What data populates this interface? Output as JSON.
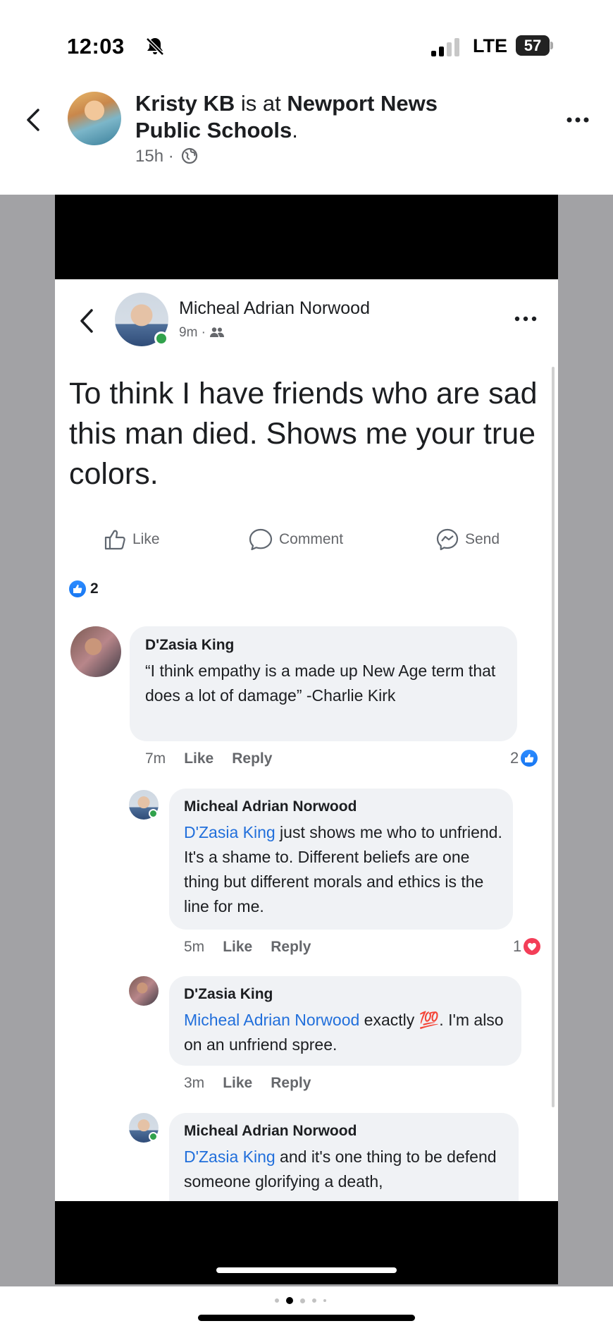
{
  "status_bar": {
    "time": "12:03",
    "network": "LTE",
    "battery": "57"
  },
  "post": {
    "author": "Kristy KB",
    "connector": " is at ",
    "location": "Newport News Public Schools",
    "location_suffix": ".",
    "time": "15h",
    "separator": " · ",
    "privacy_icon": "globe-icon"
  },
  "inner_post": {
    "author": "Micheal Adrian Norwood",
    "time": "9m",
    "separator": " · ",
    "privacy_icon": "friends-icon",
    "text": "To think I have friends who are sad this man died. Shows me your true colors.",
    "actions": {
      "like": "Like",
      "comment": "Comment",
      "send": "Send"
    },
    "reaction_count": "2",
    "comments": [
      {
        "author": "D'Zasia King",
        "text": "“I think empathy is a made up New Age term that does a lot of damage” -Charlie Kirk",
        "time": "7m",
        "like": "Like",
        "reply": "Reply",
        "reaction_count": "2",
        "reaction_type": "like"
      },
      {
        "author": "Micheal Adrian Norwood",
        "mention": "D'Zasia King",
        "text": " just shows me who to unfriend. It's a shame to. Different beliefs are one thing but different morals and ethics is the line for me.",
        "time": "5m",
        "like": "Like",
        "reply": "Reply",
        "reaction_count": "1",
        "reaction_type": "love"
      },
      {
        "author": "D'Zasia King",
        "mention": "Micheal Adrian Norwood",
        "text": " exactly 💯. I'm also on an unfriend spree.",
        "time": "3m",
        "like": "Like",
        "reply": "Reply"
      },
      {
        "author": "Micheal Adrian Norwood",
        "mention": "D'Zasia King",
        "text": " and it's one thing to be defend someone glorifying a death,"
      }
    ]
  },
  "colors": {
    "link_blue": "#216fdb",
    "like_blue": "#1877f2",
    "love_red": "#f33e58",
    "bubble_grey": "#f0f2f5",
    "meta_grey": "#65676b",
    "photo_bg": "#a2a2a5"
  }
}
